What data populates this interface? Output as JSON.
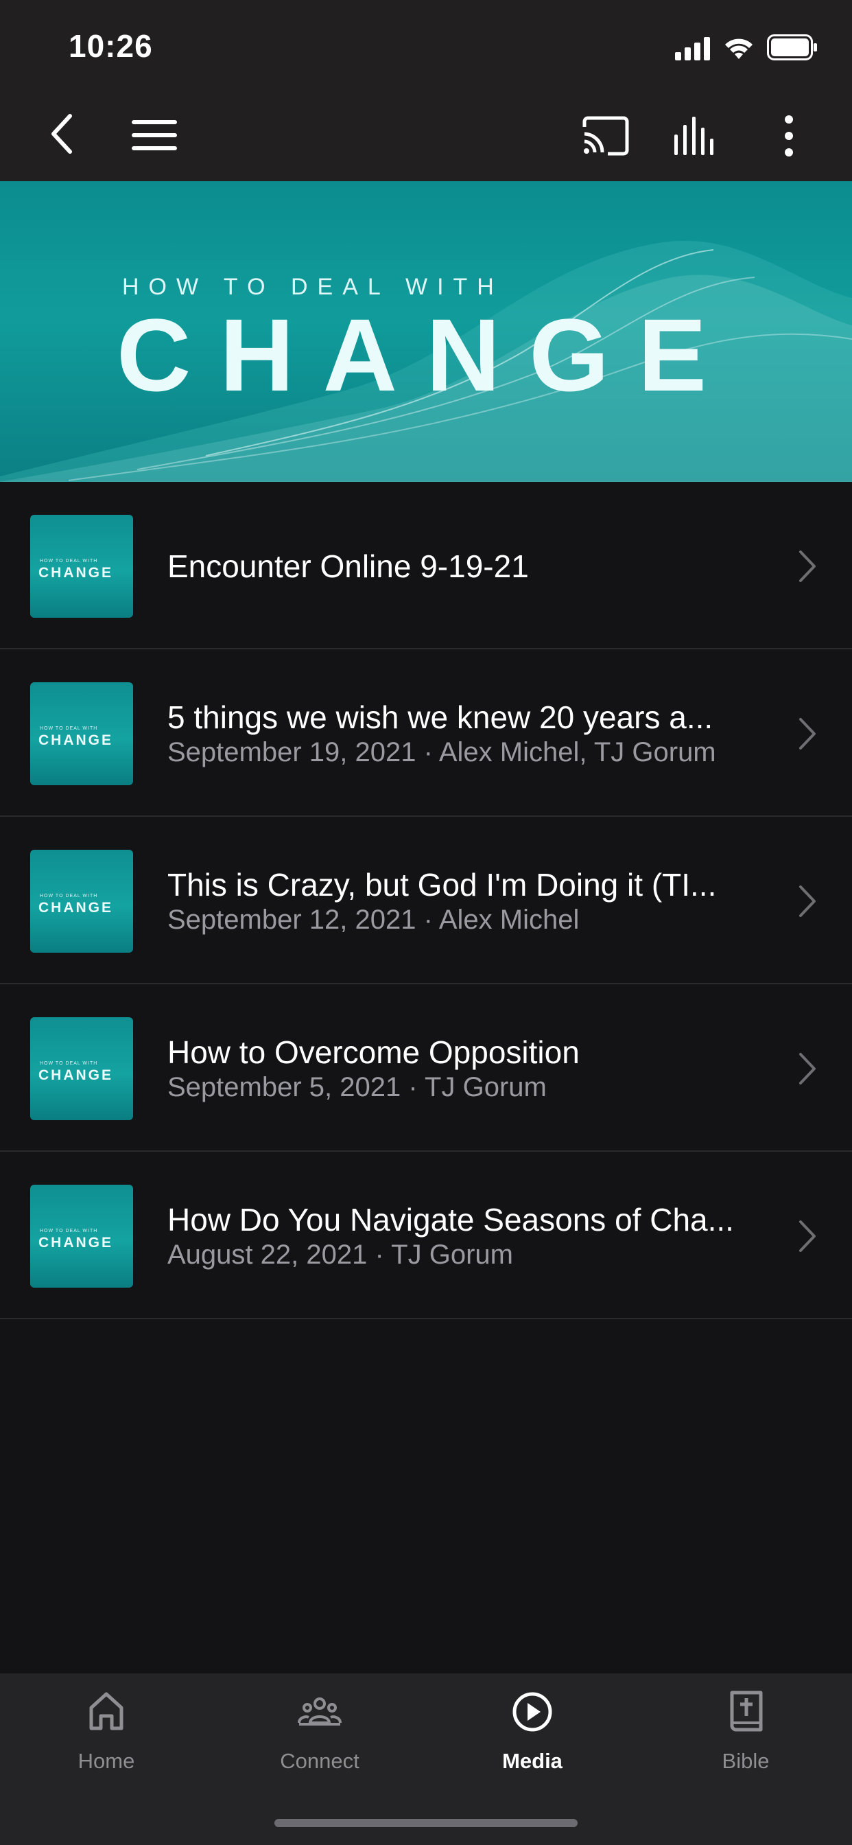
{
  "status_bar": {
    "time": "10:26"
  },
  "nav": {
    "back_icon": "chevron-left-icon",
    "menu_icon": "hamburger-icon",
    "cast_icon": "cast-icon",
    "audio_icon": "audio-bars-icon",
    "more_icon": "more-vertical-icon"
  },
  "banner": {
    "kicker": "HOW TO DEAL WITH",
    "title": "CHANGE"
  },
  "thumb": {
    "kicker": "HOW TO DEAL WITH",
    "title": "CHANGE"
  },
  "episodes": [
    {
      "title": "Encounter Online 9-19-21",
      "subtitle": ""
    },
    {
      "title": "5 things we wish we knew 20 years a...",
      "subtitle": "September 19, 2021 · Alex Michel, TJ Gorum"
    },
    {
      "title": "This is Crazy, but God I'm Doing it (TI...",
      "subtitle": "September 12, 2021 · Alex Michel"
    },
    {
      "title": "How to Overcome Opposition",
      "subtitle": "September 5, 2021 · TJ Gorum"
    },
    {
      "title": "How Do You Navigate Seasons of Cha...",
      "subtitle": "August 22, 2021 · TJ Gorum"
    }
  ],
  "tabs": [
    {
      "label": "Home",
      "icon": "home-icon",
      "active": false
    },
    {
      "label": "Connect",
      "icon": "people-icon",
      "active": false
    },
    {
      "label": "Media",
      "icon": "play-circle-icon",
      "active": true
    },
    {
      "label": "Bible",
      "icon": "bible-icon",
      "active": false
    }
  ],
  "colors": {
    "banner": "#119c9b",
    "background": "#131315",
    "tabbar": "#242426",
    "muted_text": "#9a9aa0"
  }
}
